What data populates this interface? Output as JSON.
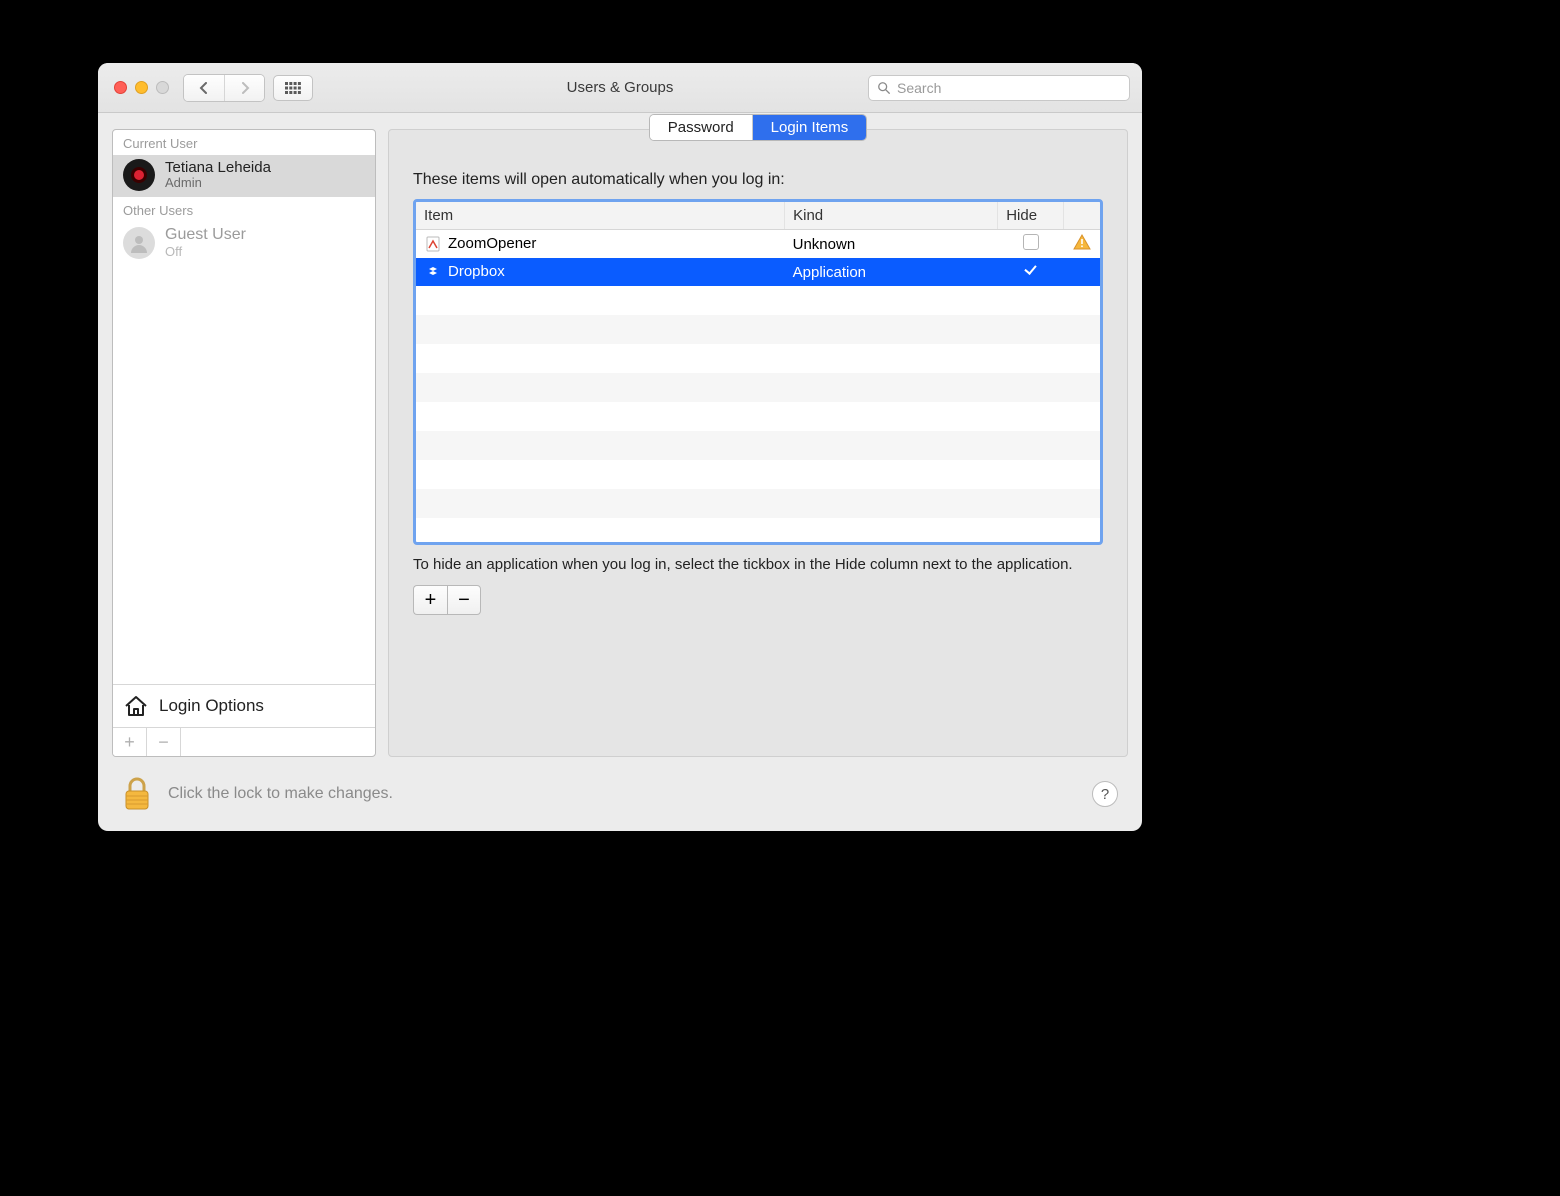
{
  "window": {
    "title": "Users & Groups"
  },
  "search": {
    "placeholder": "Search"
  },
  "sidebar": {
    "current_label": "Current User",
    "other_label": "Other Users",
    "current_user": {
      "name": "Tetiana Leheida",
      "role": "Admin"
    },
    "guest_user": {
      "name": "Guest User",
      "status": "Off"
    },
    "login_options_label": "Login Options"
  },
  "tabs": {
    "password": "Password",
    "login_items": "Login Items"
  },
  "main": {
    "intro": "These items will open automatically when you log in:",
    "columns": {
      "item": "Item",
      "kind": "Kind",
      "hide": "Hide"
    },
    "rows": [
      {
        "name": "ZoomOpener",
        "kind": "Unknown",
        "hide": false,
        "warn": true,
        "selected": false,
        "icon": "app-generic"
      },
      {
        "name": "Dropbox",
        "kind": "Application",
        "hide": true,
        "warn": false,
        "selected": true,
        "icon": "dropbox"
      }
    ],
    "hint": "To hide an application when you log in, select the tickbox in the Hide column next to the application."
  },
  "footer": {
    "text": "Click the lock to make changes.",
    "help": "?"
  },
  "glyphs": {
    "plus": "+",
    "minus": "−"
  }
}
